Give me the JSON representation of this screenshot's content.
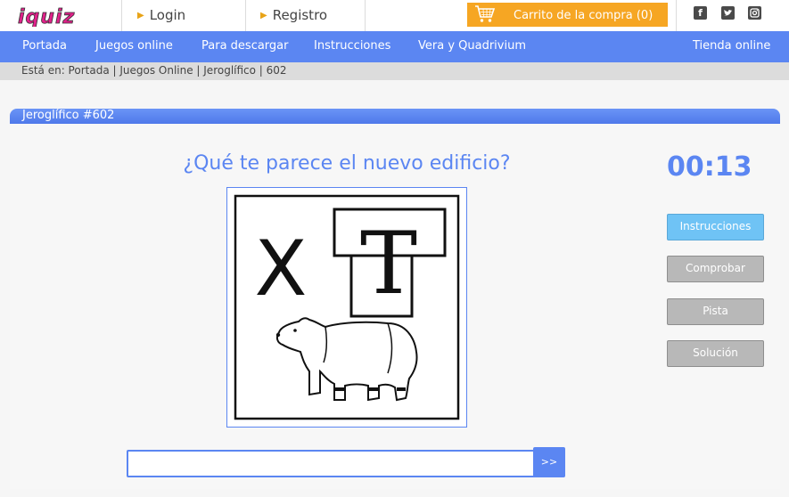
{
  "header": {
    "logo_text": "iquiz",
    "login_label": "Login",
    "register_label": "Registro",
    "cart_label": "Carrito de la compra (0)",
    "social": [
      "facebook-icon",
      "twitter-icon",
      "instagram-icon"
    ]
  },
  "nav": {
    "items": [
      {
        "label": "Portada"
      },
      {
        "label": "Juegos online"
      },
      {
        "label": "Para descargar"
      },
      {
        "label": "Instrucciones"
      },
      {
        "label": "Vera y Quadrivium"
      }
    ],
    "shop_label": "Tienda online"
  },
  "breadcrumb": "Está en: Portada | Juegos Online | Jeroglífico | 602",
  "puzzle": {
    "title": "Jeroglífico #602",
    "question": "¿Qué te parece el nuevo edificio?",
    "image_letters": {
      "left": "X",
      "right": "T"
    },
    "timer": "00:13",
    "answer_value": "",
    "submit_label": ">>"
  },
  "actions": {
    "instructions": "Instrucciones",
    "check": "Comprobar",
    "hint": "Pista",
    "solution": "Solución"
  },
  "colors": {
    "brand_blue": "#5b86f2",
    "cart_orange": "#f6a623",
    "primary_button": "#6fc3f5",
    "disabled_button": "#b8b8b8"
  }
}
